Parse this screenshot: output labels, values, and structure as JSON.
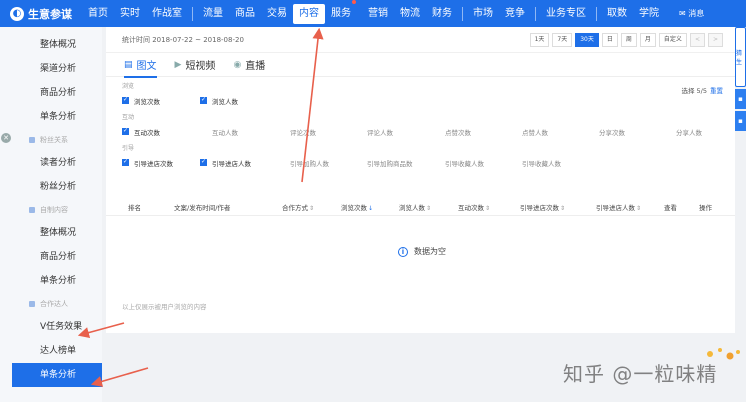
{
  "brand": {
    "name": "生意参谋"
  },
  "nav": {
    "items": [
      "首页",
      "实时",
      "作战室",
      "流量",
      "商品",
      "交易",
      "内容",
      "服务",
      "营销",
      "物流",
      "财务",
      "市场",
      "竞争",
      "业务专区",
      "取数",
      "学院"
    ],
    "active": "内容",
    "message": "消息"
  },
  "sidebar": {
    "toggle": "✕",
    "sections": [
      {
        "title": "",
        "items": [
          "整体概况",
          "渠道分析",
          "商品分析",
          "单条分析"
        ]
      },
      {
        "title": "粉丝关系",
        "items": [
          "读者分析",
          "粉丝分析"
        ]
      },
      {
        "title": "自制内容",
        "items": [
          "整体概况",
          "商品分析",
          "单条分析"
        ]
      },
      {
        "title": "合作达人",
        "items": [
          "V任务效果",
          "达人榜单",
          "单条分析"
        ]
      }
    ],
    "active_item": "单条分析"
  },
  "stats": {
    "label": "统计时间 2018-07-22 ~ 2018-08-20",
    "ranges": [
      "1天",
      "7天",
      "30天",
      "日",
      "周",
      "月",
      "自定义",
      "<",
      ">"
    ],
    "active_range": "30天"
  },
  "tabs": [
    {
      "label": "图文",
      "icon": "document-icon"
    },
    {
      "label": "短视频",
      "icon": "video-icon"
    },
    {
      "label": "直播",
      "icon": "live-icon"
    }
  ],
  "filters": {
    "select_info": "选择 5/5",
    "reset": "重置",
    "groups": [
      {
        "title": "浏览",
        "options": [
          {
            "label": "浏览次数",
            "checked": true
          },
          {
            "label": "浏览人数",
            "checked": true
          }
        ]
      },
      {
        "title": "互动",
        "options": [
          {
            "label": "互动次数",
            "checked": true
          },
          {
            "label": "互动人数",
            "checked": false
          },
          {
            "label": "评论次数",
            "checked": false
          },
          {
            "label": "评论人数",
            "checked": false
          },
          {
            "label": "点赞次数",
            "checked": false
          },
          {
            "label": "点赞人数",
            "checked": false
          },
          {
            "label": "分享次数",
            "checked": false
          },
          {
            "label": "分享人数",
            "checked": false
          }
        ]
      },
      {
        "title": "引导",
        "options": [
          {
            "label": "引导进店次数",
            "checked": true
          },
          {
            "label": "引导进店人数",
            "checked": true
          },
          {
            "label": "引导加购人数",
            "checked": false
          },
          {
            "label": "引导加购商品数",
            "checked": false
          },
          {
            "label": "引导收藏人数",
            "checked": false
          },
          {
            "label": "引导收藏人数",
            "checked": false
          }
        ]
      }
    ]
  },
  "table": {
    "headers": [
      "排名",
      "文案/发布时间/作者",
      "合作方式",
      "浏览次数",
      "浏览人数",
      "互动次数",
      "引导进店次数",
      "引导进店人数",
      "查看",
      "操作"
    ],
    "empty_text": "数据为空"
  },
  "footnote": "以上仅展示被用户浏览的内容",
  "right_panel": {
    "label": "猜生"
  },
  "watermark": "知乎 @一粒味精",
  "colors": {
    "primary": "#1e6fe8",
    "annotation": "#e8604c"
  }
}
